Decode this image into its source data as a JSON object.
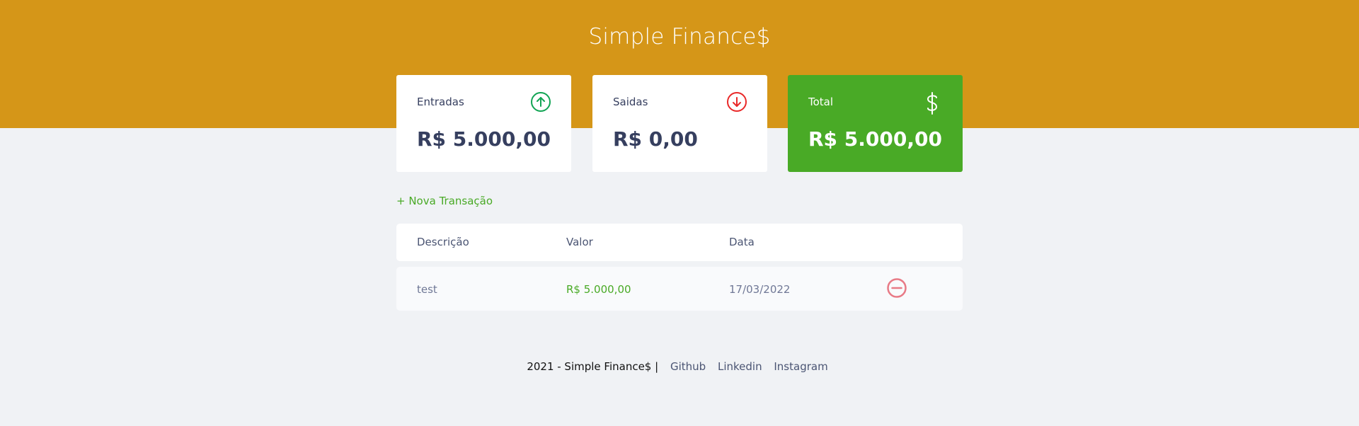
{
  "header": {
    "logo": "Simple Finance$"
  },
  "cards": {
    "income": {
      "title": "Entradas",
      "value": "R$ 5.000,00",
      "icon": "arrow-up-circle-icon",
      "icon_color": "#12a454"
    },
    "expense": {
      "title": "Saidas",
      "value": "R$ 0,00",
      "icon": "arrow-down-circle-icon",
      "icon_color": "#e92929"
    },
    "total": {
      "title": "Total",
      "value": "R$ 5.000,00",
      "icon": "dollar-icon",
      "background": "#49aa26"
    }
  },
  "actions": {
    "new_transaction": "+ Nova Transação"
  },
  "table": {
    "headers": [
      "Descrição",
      "Valor",
      "Data"
    ],
    "rows": [
      {
        "description": "test",
        "amount": "R$ 5.000,00",
        "date": "17/03/2022",
        "remove_icon": "minus-circle-icon"
      }
    ]
  },
  "footer": {
    "copyright": "2021 - Simple Finance$",
    "separator": "|",
    "links": [
      "Github",
      "Linkedin",
      "Instagram"
    ]
  },
  "colors": {
    "header": "#d59618",
    "accent": "#49aa26",
    "background": "#f0f2f5",
    "text": "#363f5f",
    "remove": "#e92929"
  }
}
